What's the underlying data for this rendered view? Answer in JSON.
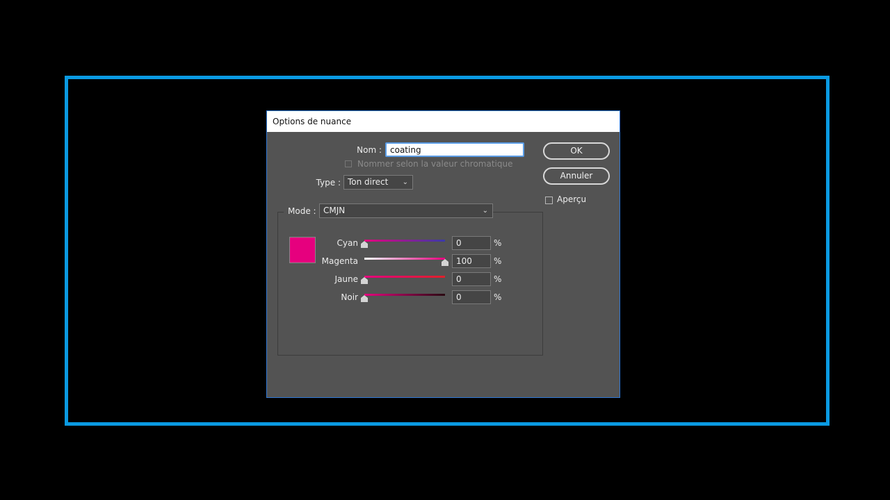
{
  "dialog": {
    "title": "Options de nuance",
    "name_label": "Nom :",
    "name_value": "coating",
    "name_by_value_label": "Nommer selon la valeur chromatique",
    "type_label": "Type :",
    "type_value": "Ton direct",
    "mode_label": "Mode :",
    "mode_value": "CMJN",
    "ok_label": "OK",
    "cancel_label": "Annuler",
    "preview_label": "Aperçu",
    "percent_symbol": "%"
  },
  "colors": {
    "swatch": "#e6007e",
    "accent_border": "#0a9ae2"
  },
  "sliders": [
    {
      "label": "Cyan",
      "value": "0",
      "percent": 0
    },
    {
      "label": "Magenta",
      "value": "100",
      "percent": 100
    },
    {
      "label": "Jaune",
      "value": "0",
      "percent": 0
    },
    {
      "label": "Noir",
      "value": "0",
      "percent": 0
    }
  ]
}
